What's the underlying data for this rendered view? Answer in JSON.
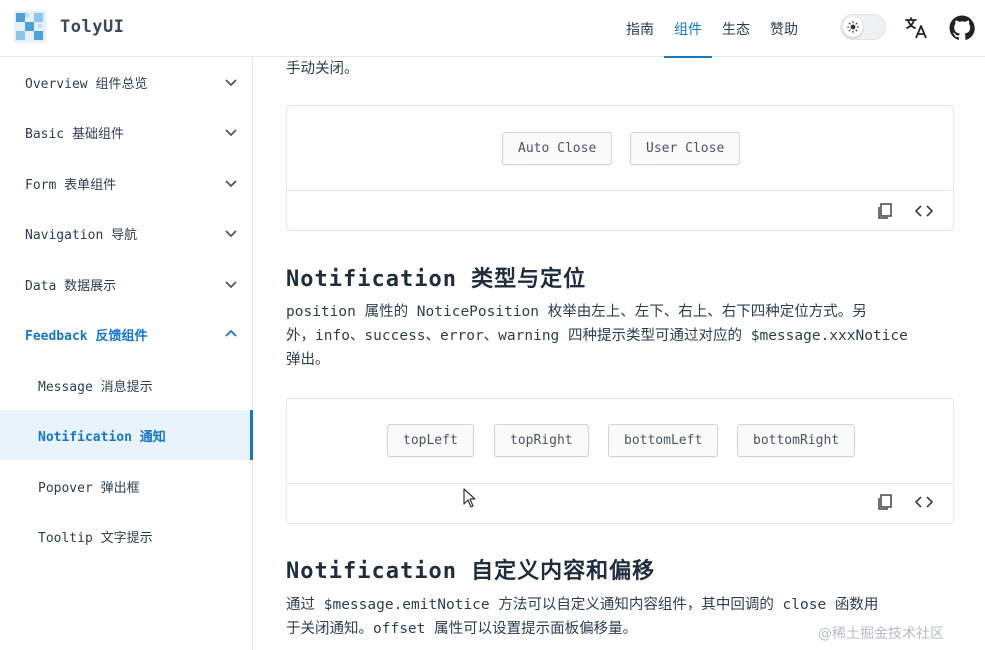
{
  "header": {
    "brand": "TolyUI",
    "nav": [
      "指南",
      "组件",
      "生态",
      "赞助"
    ],
    "active_nav": 1
  },
  "sidebar": {
    "groups": [
      {
        "label": "Overview 组件总览"
      },
      {
        "label": "Basic 基础组件"
      },
      {
        "label": "Form 表单组件"
      },
      {
        "label": "Navigation 导航"
      },
      {
        "label": "Data 数据展示"
      },
      {
        "label": "Feedback 反馈组件"
      }
    ],
    "sub_items": [
      {
        "label": "Message 消息提示"
      },
      {
        "label": "Notification  通知"
      },
      {
        "label": "Popover 弹出框"
      },
      {
        "label": "Tooltip 文字提示"
      }
    ]
  },
  "content": {
    "top_text": "手动关闭。",
    "demo1": {
      "buttons": [
        "Auto Close",
        "User Close"
      ]
    },
    "section1": {
      "title": "Notification 类型与定位",
      "desc_line1": "position 属性的 NoticePosition 枚举由左上、左下、右上、右下四种定位方式。另",
      "desc_line2": "外，info、success、error、warning 四种提示类型可通过对应的 $message.xxxNotice",
      "desc_line3": "弹出。"
    },
    "demo2": {
      "buttons": [
        "topLeft",
        "topRight",
        "bottomLeft",
        "bottomRight"
      ]
    },
    "section2": {
      "title": "Notification 自定义内容和偏移",
      "desc_line1": "通过 $message.emitNotice 方法可以自定义通知内容组件，其中回调的 close 函数用",
      "desc_line2": "于关闭通知。offset 属性可以设置提示面板偏移量。"
    }
  },
  "watermark": "@稀土掘金技术社区",
  "colors": {
    "accent": "#1677c9",
    "text": "#2c3e50",
    "border": "#e3e6ea"
  }
}
